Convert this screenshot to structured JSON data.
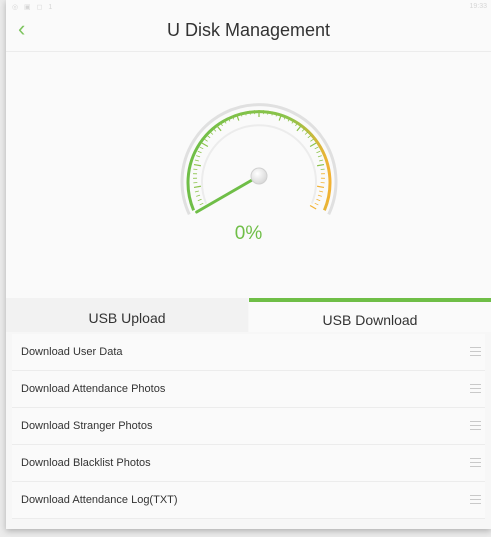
{
  "status_bar": {
    "left_icons": [
      "notification-icon",
      "image-icon",
      "app-icon",
      "number-icon"
    ],
    "right_icons": [
      "bluetooth-icon",
      "wifi-icon",
      "signal-icon"
    ],
    "time": "19:33"
  },
  "header": {
    "title": "U Disk Management",
    "back_icon": "chevron-left-icon"
  },
  "gauge": {
    "value_label": "0%",
    "progress": 0,
    "colors": {
      "arc_start": "#6fbe47",
      "arc_end": "#f2b233",
      "needle": "#6fbe47",
      "outline": "#dcdcdc"
    }
  },
  "tabs": [
    {
      "label": "USB Upload",
      "active": false
    },
    {
      "label": "USB Download",
      "active": true
    }
  ],
  "list": {
    "items": [
      {
        "label": "Download User Data"
      },
      {
        "label": "Download Attendance Photos"
      },
      {
        "label": "Download Stranger Photos"
      },
      {
        "label": "Download Blacklist Photos"
      },
      {
        "label": "Download Attendance Log(TXT)"
      }
    ],
    "handle_icon": "drag-handle-icon"
  },
  "colors": {
    "accent": "#6fbe47",
    "background": "#f7f7f7"
  }
}
